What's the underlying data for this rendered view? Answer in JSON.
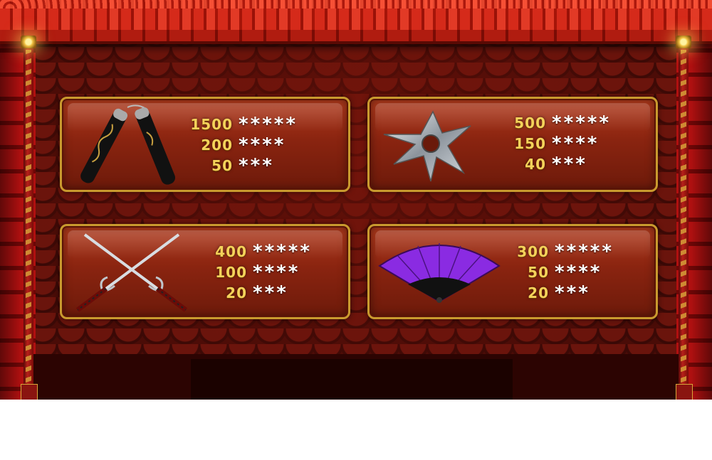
{
  "paytable": [
    {
      "symbol_icon": "nunchaku-icon",
      "payouts": [
        {
          "amount": "1500",
          "stars": "*****"
        },
        {
          "amount": "200",
          "stars": "****"
        },
        {
          "amount": "50",
          "stars": "***"
        }
      ]
    },
    {
      "symbol_icon": "shuriken-icon",
      "payouts": [
        {
          "amount": "500",
          "stars": "*****"
        },
        {
          "amount": "150",
          "stars": "****"
        },
        {
          "amount": "40",
          "stars": "***"
        }
      ]
    },
    {
      "symbol_icon": "sai-icon",
      "payouts": [
        {
          "amount": "400",
          "stars": "*****"
        },
        {
          "amount": "100",
          "stars": "****"
        },
        {
          "amount": "20",
          "stars": "***"
        }
      ]
    },
    {
      "symbol_icon": "fan-icon",
      "payouts": [
        {
          "amount": "300",
          "stars": "*****"
        },
        {
          "amount": "50",
          "stars": "****"
        },
        {
          "amount": "20",
          "stars": "***"
        }
      ]
    }
  ],
  "colors": {
    "gold": "#f4d25a",
    "panel_border": "#c99a2e",
    "panel_fill": "#8a2410",
    "roof_red": "#d52a1a",
    "fan_purple": "#8a2be2"
  }
}
